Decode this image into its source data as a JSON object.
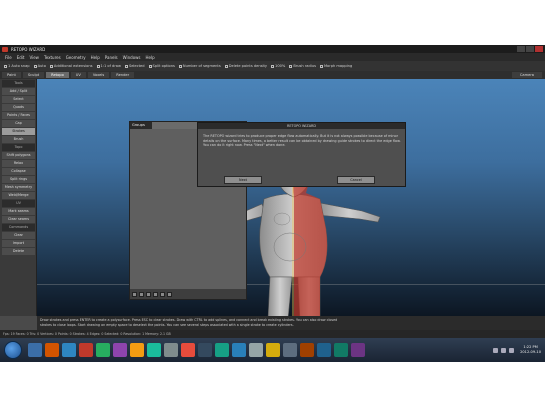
{
  "menu": {
    "items": [
      "File",
      "Edit",
      "View",
      "Textures",
      "Geometry",
      "Help",
      "Panels",
      "Windows",
      "Help"
    ]
  },
  "options": {
    "items": [
      "1 Auto snap",
      "Auto",
      "Additional extensions",
      "1:1 of draw",
      "Selected",
      "Split options",
      "Number of segments",
      "Delete points density",
      "100%",
      "Brush radius",
      "Morph mapping"
    ]
  },
  "tabs": {
    "items": [
      "Paint",
      "Sculpt",
      "Retopo",
      "UV",
      "Voxels",
      "Render"
    ],
    "camera_label": "Camera"
  },
  "left_panel": {
    "items": [
      "Tools",
      "Add / Split",
      "Select",
      "Quads",
      "Points / Faces",
      "Cap",
      "Strokes",
      "Brush",
      "Topo",
      "Shift polygons",
      "Relax",
      "Collapse",
      "Split rings",
      "Mesh symmetry",
      "Weld/Merge",
      "UV",
      "Mark seams",
      "Clear seams",
      "Commands",
      "Clear",
      "Import",
      "Delete"
    ],
    "active_index": 6
  },
  "group_panel": {
    "title": "Groups"
  },
  "wizard": {
    "title": "RETOPO WIZARD",
    "body": "The RETOPO wizard tries to produce proper edge flow automatically. But it is not always possible because of minor details on the surface. Many times, a better result can be obtained by drawing guide strokes to direct the edge flow. You can do it right now. Press \"Next\" when done.",
    "next_label": "Next",
    "cancel_label": "Cancel"
  },
  "status": {
    "line1": "Draw strokes and press ENTER to create a polysurface. Press ESC to clear strokes. Draw with CTRL to add splines, and connect and break existing strokes. You can also draw closed",
    "line2": "strokes to close loops. Start drawing on empty space to deselect the points. You can see several steps associated with a single stroke to create cylinders.",
    "line3": "Fps: 19  Faces: 0  Tris: 0  Vertices: 0  Points: 0  Strokes: 4  Edges: 0  Selected: 0  Resolution: 1  Memory: 2.1 GB"
  },
  "taskbar": {
    "app_colors": [
      "#3b6ea8",
      "#d35400",
      "#2e86c1",
      "#c0392b",
      "#27ae60",
      "#8e44ad",
      "#f39c12",
      "#1abc9c",
      "#7f8c8d",
      "#e74c3c",
      "#34495e",
      "#16a085",
      "#2980b9",
      "#95a5a6",
      "#d4ac0d",
      "#5d6d7e",
      "#a04000",
      "#1f618d",
      "#117a65",
      "#6c3483"
    ],
    "time": "1:22 PM",
    "date": "2012-09-10"
  },
  "colors": {
    "selection_red": "#c0392b",
    "active_tab": "#6a6a6a"
  }
}
